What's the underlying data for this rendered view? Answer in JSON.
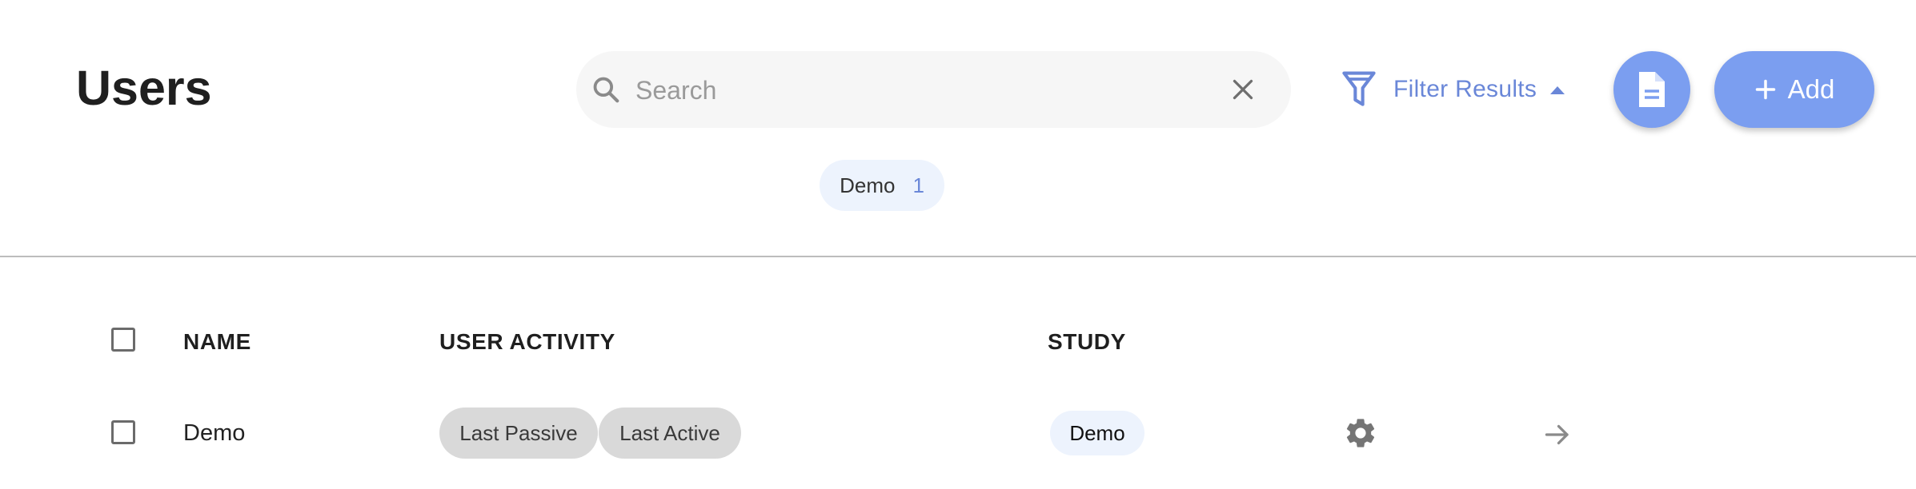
{
  "header": {
    "title": "Users"
  },
  "search": {
    "placeholder": "Search",
    "value": ""
  },
  "filter": {
    "label": "Filter Results"
  },
  "actions": {
    "add_label": "Add"
  },
  "active_filters": [
    {
      "label": "Demo",
      "count": "1"
    }
  ],
  "table": {
    "columns": [
      "NAME",
      "USER ACTIVITY",
      "STUDY"
    ],
    "rows": [
      {
        "name": "Demo",
        "activity": [
          "Last Passive",
          "Last Active"
        ],
        "study": "Demo"
      }
    ]
  },
  "colors": {
    "accent": "#7b9ef0",
    "link": "#6a87d8",
    "chip_bg": "#edf3fd",
    "activity_chip_bg": "#d9d9d9"
  },
  "icons": [
    "search-icon",
    "clear-icon",
    "filter-icon",
    "caret-up-icon",
    "document-icon",
    "plus-icon",
    "gear-icon",
    "arrow-right-icon"
  ]
}
